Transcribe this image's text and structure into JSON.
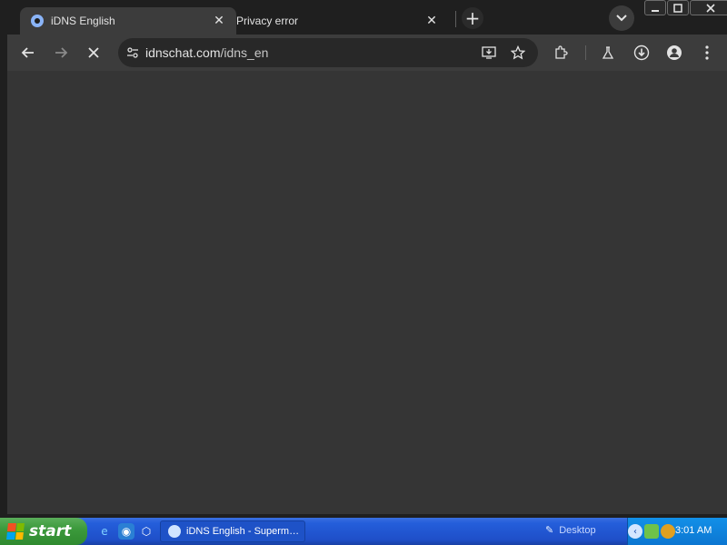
{
  "tabs": [
    {
      "title": "iDNS English",
      "active": true
    },
    {
      "title": "Privacy error",
      "active": false
    }
  ],
  "toolbar": {
    "url_host": "idnschat.com",
    "url_path": "/idns_en"
  },
  "taskbar": {
    "start_label": "start",
    "task_title": "iDNS English - Superm…",
    "desktop_label": "Desktop",
    "clock": "3:01 AM"
  },
  "colors": {
    "content_bg": "#353535",
    "toolbar_bg": "#3c3c3c",
    "taskbar_blue": "#245edb",
    "start_green": "#3c9a3c"
  }
}
